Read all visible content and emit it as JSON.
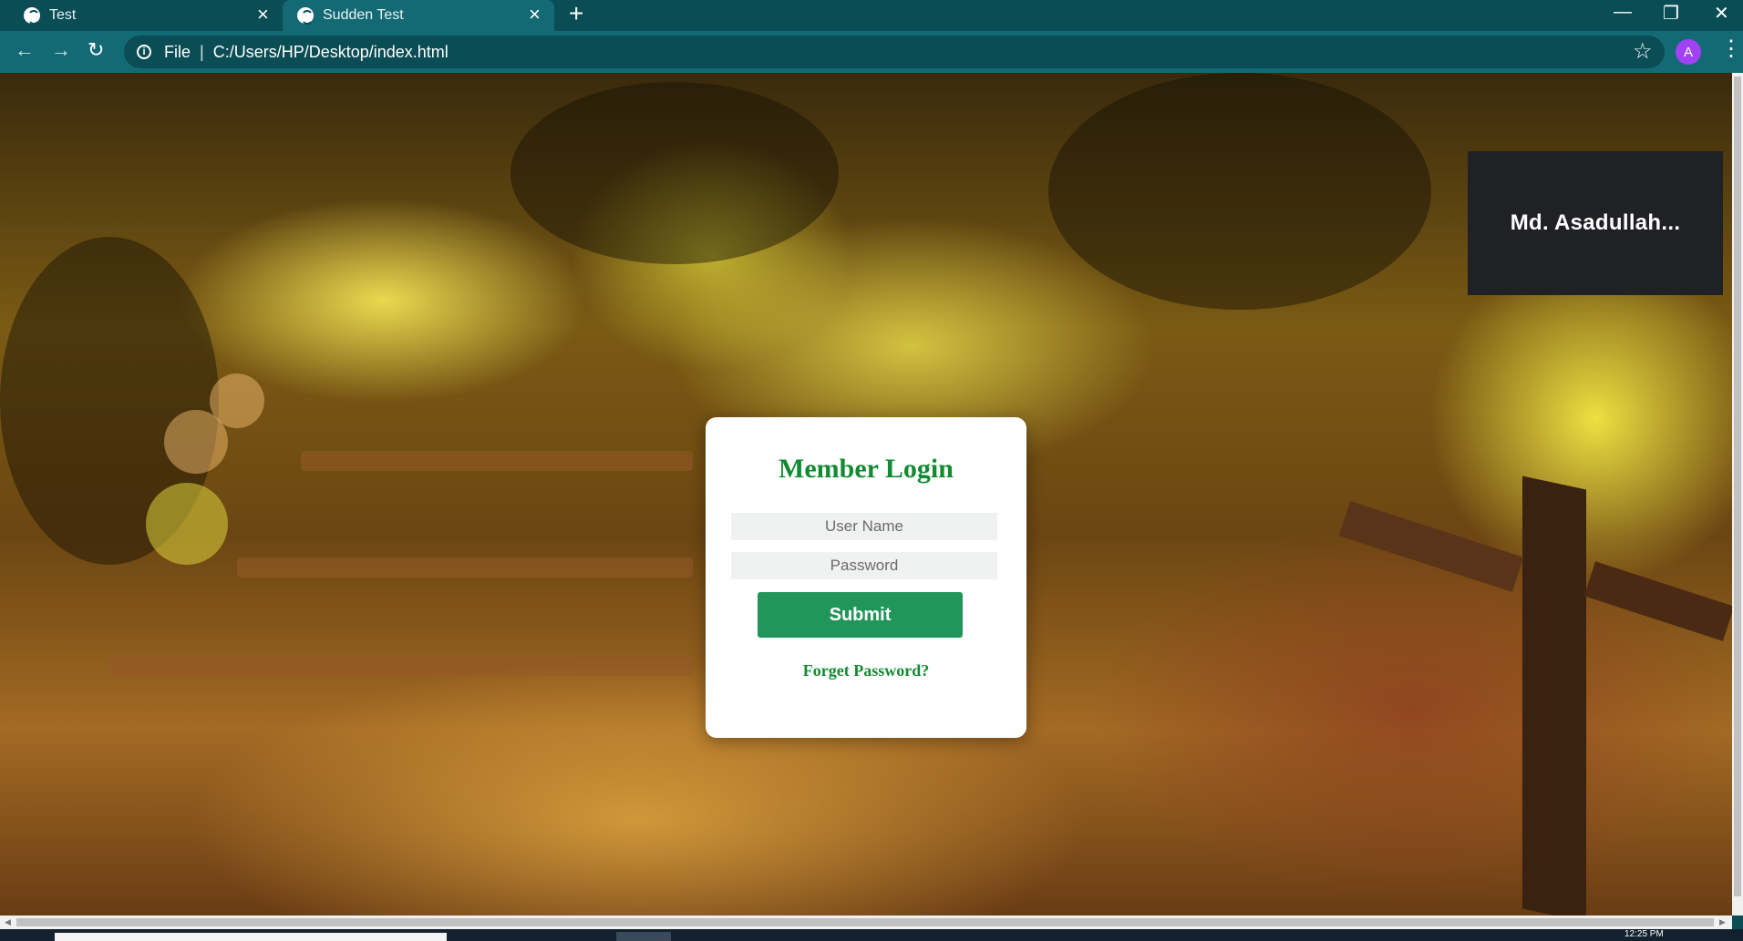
{
  "browser": {
    "tabs": [
      {
        "title": "Test",
        "close": "×"
      },
      {
        "title": "Sudden Test",
        "close": "×"
      }
    ],
    "new_tab": "+",
    "window_controls": {
      "minimize": "—",
      "restore": "❐",
      "close": "✕"
    },
    "nav": {
      "back": "←",
      "forward": "→",
      "reload": "↻"
    },
    "address": {
      "scheme_label": "File",
      "separator": "|",
      "url": "C:/Users/HP/Desktop/index.html"
    },
    "star": "☆",
    "profile_initial": "A",
    "menu": "⋮"
  },
  "page": {
    "name_overlay": "Md.  Asadullah...",
    "login": {
      "title": "Member Login",
      "username_placeholder": "User Name",
      "password_placeholder": "Password",
      "submit_label": "Submit",
      "forget_link": "Forget Password?"
    }
  },
  "taskbar": {
    "clock": "12:25 PM"
  },
  "colors": {
    "chrome_dark": "#0b4d55",
    "chrome_light": "#146a74",
    "brand_green": "#128a31",
    "button_green": "#22965a",
    "avatar_purple": "#a142f4",
    "overlay_bg": "#202124"
  }
}
